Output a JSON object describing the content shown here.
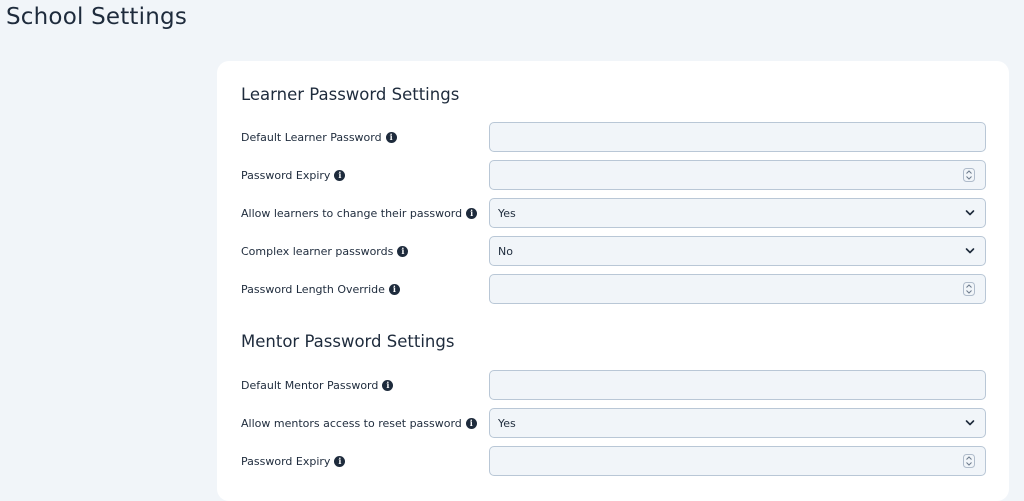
{
  "page": {
    "title": "School Settings"
  },
  "learner_section": {
    "title": "Learner Password Settings",
    "rows": [
      {
        "label": "Default Learner Password",
        "value": ""
      },
      {
        "label": "Password Expiry",
        "value": ""
      },
      {
        "label": "Allow learners to change their password",
        "value": "Yes"
      },
      {
        "label": "Complex learner passwords",
        "value": "No"
      },
      {
        "label": "Password Length Override",
        "value": ""
      }
    ]
  },
  "mentor_section": {
    "title": "Mentor Password Settings",
    "rows": [
      {
        "label": "Default Mentor Password",
        "value": ""
      },
      {
        "label": "Allow mentors access to reset password",
        "value": "Yes"
      },
      {
        "label": "Password Expiry",
        "value": ""
      }
    ]
  },
  "icons": {
    "info": "info-icon",
    "select": "chevron-down-icon",
    "number": "spinner-icon"
  },
  "colors": {
    "background": "#f1f5f9",
    "card": "#ffffff",
    "text": "#1e2b3c",
    "field_border": "#b9c7d6",
    "field_fill": "#f1f5f9"
  }
}
